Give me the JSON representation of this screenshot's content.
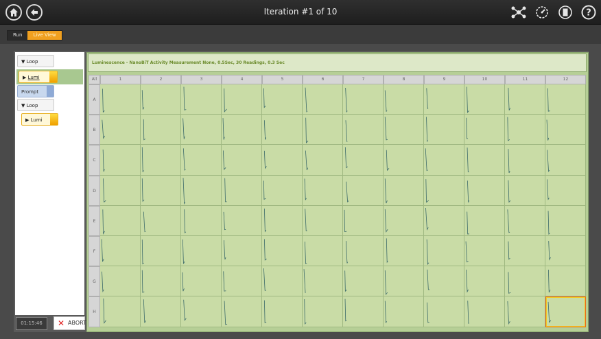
{
  "topbar": {
    "title": "Iteration #1 of 10",
    "left_icons": [
      "home-icon",
      "back-arrow-icon"
    ],
    "right_icons": [
      "network-icon",
      "gauge-icon",
      "door-icon",
      "help-icon"
    ],
    "help_glyph": "?"
  },
  "tabs": [
    {
      "label": "Run",
      "active": false
    },
    {
      "label": "Live View",
      "active": true
    }
  ],
  "workflow": [
    {
      "type": "loop",
      "label": "Loop"
    },
    {
      "type": "lumi",
      "label": "Lumi",
      "selected": true
    },
    {
      "type": "prompt",
      "label": "Prompt"
    },
    {
      "type": "loop",
      "label": "Loop"
    },
    {
      "type": "lumi",
      "label": "Lumi"
    }
  ],
  "timer": "01:15:46",
  "abort_label": "ABORT",
  "measurement_header": "Luminescence - NanoBiT Activity Measurement None, 0.5Sec, 30 Readings, 0.3 Sec",
  "plate": {
    "all_label": "All",
    "columns": [
      "1",
      "2",
      "3",
      "4",
      "5",
      "6",
      "7",
      "8",
      "9",
      "10",
      "11",
      "12"
    ],
    "rows": [
      "A",
      "B",
      "C",
      "D",
      "E",
      "F",
      "G",
      "H"
    ],
    "highlighted_well": "H12"
  },
  "colors": {
    "accent": "#f0a020",
    "well_fill": "#c9dca6",
    "trace": "#3c6a6a",
    "highlight": "#e86c1a"
  }
}
